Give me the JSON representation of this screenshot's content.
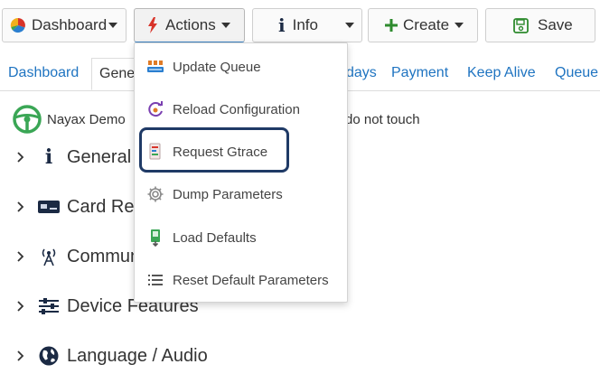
{
  "toolbar": {
    "dashboard_label": "Dashboard",
    "actions_label": "Actions",
    "info_label": "Info",
    "create_label": "Create",
    "save_label": "Save"
  },
  "tabs": [
    {
      "label": "Dashboard"
    },
    {
      "label": "Gene"
    },
    {
      "label": "days"
    },
    {
      "label": "Payment"
    },
    {
      "label": "Keep Alive"
    },
    {
      "label": "Queue"
    }
  ],
  "device": {
    "name": "Nayax Demo",
    "note": "do not touch"
  },
  "sections": [
    {
      "label": "General",
      "icon": "info-icon"
    },
    {
      "label": "Card Rea",
      "icon": "card-reader-icon"
    },
    {
      "label": "Commun",
      "icon": "antenna-icon"
    },
    {
      "label": "Device Features",
      "icon": "device-features-icon"
    },
    {
      "label": "Language / Audio",
      "icon": "globe-icon"
    }
  ],
  "actions_menu": {
    "items": [
      {
        "label": "Update Queue",
        "icon": "update-queue-icon"
      },
      {
        "label": "Reload Configuration",
        "icon": "reload-icon"
      },
      {
        "label": "Request Gtrace",
        "icon": "gtrace-icon",
        "highlighted": true
      },
      {
        "label": "Dump Parameters",
        "icon": "gear-icon"
      },
      {
        "label": "Load Defaults",
        "icon": "load-defaults-icon"
      },
      {
        "label": "Reset Default Parameters",
        "icon": "list-icon"
      }
    ]
  },
  "colors": {
    "link": "#1f74c1",
    "highlight_border": "#1f3a66",
    "create_plus": "#2e8b2e",
    "save_icon": "#2e8b2e",
    "actions_icon": "#d8342a"
  }
}
